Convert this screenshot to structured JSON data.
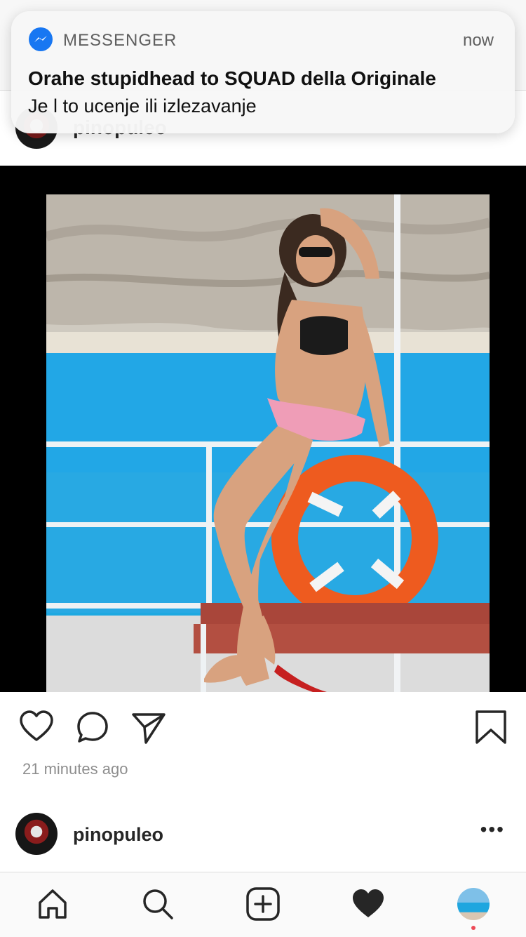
{
  "notification": {
    "app_icon": "messenger-icon",
    "app_name": "MESSENGER",
    "time": "now",
    "title": "Orahe stupidhead to SQUAD della Originale",
    "body": "Je l to ucenje ili izlezavanje"
  },
  "post_above": {
    "username": "pinopuleo"
  },
  "post": {
    "image_icon": "photo-woman-on-boat",
    "actions": [
      "heart-icon",
      "comment-icon",
      "share-icon",
      "bookmark-icon"
    ],
    "timestamp": "21 minutes ago"
  },
  "next_post": {
    "username": "pinopuleo",
    "more_label": "•••"
  },
  "tabbar": {
    "items": [
      "home-icon",
      "search-icon",
      "add-post-icon",
      "activity-heart-icon",
      "profile-avatar"
    ]
  },
  "colors": {
    "messenger_blue": "#1877f2",
    "notification_dot": "#ed4956",
    "sea": "#1fa6df"
  }
}
